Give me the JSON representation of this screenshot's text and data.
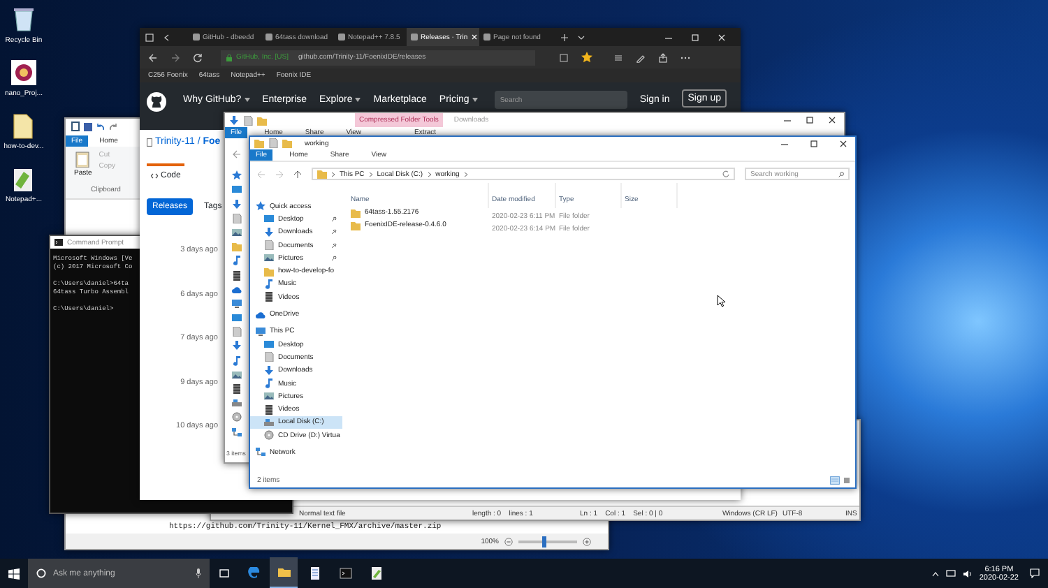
{
  "desktop_icons": [
    {
      "label": "Recycle Bin",
      "kind": "bin"
    },
    {
      "label": "nano_Proj...",
      "kind": "app"
    },
    {
      "label": "how-to-dev...",
      "kind": "file"
    },
    {
      "label": "Notepad+...",
      "kind": "notepad"
    }
  ],
  "wordpad": {
    "ribbon_tabs": [
      {
        "label": "File",
        "selected": true
      },
      {
        "label": "Home",
        "selected": false
      }
    ],
    "paste": "Paste",
    "small_buttons": [
      {
        "label": "Cut",
        "disabled": true
      },
      {
        "label": "Copy",
        "disabled": true
      }
    ],
    "group_label": "Clipboard",
    "lines": [
      "https://github.com/Trinity-11/Kernel_FMX/archive/master.zip"
    ],
    "zoom": "100%",
    "level": 0.45
  },
  "notepadpp": {
    "status_bar": [
      "Normal text file",
      "length : 0    lines : 1",
      "Ln : 1    Col : 1    Sel : 0 | 0",
      "Windows (CR LF)",
      "UTF-8",
      "INS"
    ]
  },
  "command_prompt": {
    "title": "Command Prompt",
    "blocks": [
      [
        "Microsoft Windows [Ve",
        "(c) 2017 Microsoft Co"
      ],
      [
        "C:\\Users\\daniel>64ta",
        "64tass Turbo Assembl"
      ],
      [
        "C:\\Users\\daniel>"
      ]
    ]
  },
  "browser": {
    "tabs": [
      {
        "label": "GitHub - dbeedd",
        "selected": false
      },
      {
        "label": "64tass download",
        "selected": false
      },
      {
        "label": "Notepad++ 7.8.5",
        "selected": false
      },
      {
        "label": "Releases · Trin",
        "selected": true
      },
      {
        "label": "Page not found",
        "selected": false
      }
    ],
    "certificate": "GitHub, Inc. [US]",
    "url": "github.com/Trinity-11/FoenixIDE/releases",
    "bookmarks": [
      "C256 Foenix",
      "64tass",
      "Notepad++",
      "Foenix IDE"
    ],
    "nav": [
      {
        "label": "Why GitHub?",
        "dropdown": true
      },
      {
        "label": "Enterprise",
        "dropdown": false
      },
      {
        "label": "Explore",
        "dropdown": true
      },
      {
        "label": "Marketplace",
        "dropdown": false
      },
      {
        "label": "Pricing",
        "dropdown": true
      }
    ],
    "search_placeholder": "Search",
    "sign_in": "Sign in",
    "sign_up": "Sign up",
    "repo": "Trinity-11 / **Foe**",
    "repo_tabs": [
      {
        "label": "Code",
        "selected": true
      }
    ],
    "release_tabs": [
      {
        "label": "Releases",
        "selected": true
      },
      {
        "label": "Tags",
        "selected": false
      }
    ],
    "dates": [
      "3 days ago",
      "6 days ago",
      "7 days ago",
      "9 days ago",
      "10 days ago"
    ]
  },
  "explorer_back": {
    "context_label": "Compressed Folder Tools",
    "title": "Downloads",
    "ribbon_tabs": [
      {
        "label": "File",
        "selected": true
      },
      {
        "label": "Home",
        "selected": false
      },
      {
        "label": "Share",
        "selected": false
      },
      {
        "label": "View",
        "selected": false
      }
    ],
    "context_tab": "Extract",
    "status": "3 items"
  },
  "explorer": {
    "title": "working",
    "ribbon_tabs": [
      {
        "label": "File",
        "selected": true
      },
      {
        "label": "Home",
        "selected": false
      },
      {
        "label": "Share",
        "selected": false
      },
      {
        "label": "View",
        "selected": false
      }
    ],
    "breadcrumb": [
      "This PC",
      "Local Disk (C:)",
      "working"
    ],
    "search_placeholder": "Search working",
    "columns": [
      "Name",
      "Date modified",
      "Type",
      "Size"
    ],
    "rows": [
      {
        "name": "64tass-1.55.2176",
        "date": "2020-02-23 6:11 PM",
        "type": "File folder"
      },
      {
        "name": "FoenixIDE-release-0.4.6.0",
        "date": "2020-02-23 6:14 PM",
        "type": "File folder"
      }
    ],
    "nav": [
      {
        "label": "Quick access",
        "kind": "star",
        "selected": false,
        "children": [
          {
            "label": "Desktop",
            "kind": "desktop",
            "pinned": true,
            "selected": false
          },
          {
            "label": "Downloads",
            "kind": "download",
            "pinned": true,
            "selected": false
          },
          {
            "label": "Documents",
            "kind": "document",
            "pinned": true,
            "selected": false
          },
          {
            "label": "Pictures",
            "kind": "picture",
            "pinned": true,
            "selected": false
          },
          {
            "label": "how-to-develop-fo",
            "kind": "folder",
            "pinned": false,
            "selected": false
          },
          {
            "label": "Music",
            "kind": "music",
            "pinned": false,
            "selected": false
          },
          {
            "label": "Videos",
            "kind": "video",
            "pinned": false,
            "selected": false
          }
        ]
      },
      {
        "label": "OneDrive",
        "kind": "cloud",
        "selected": false
      },
      {
        "label": "This PC",
        "kind": "pc",
        "selected": false,
        "children": [
          {
            "label": "Desktop",
            "kind": "desktop",
            "selected": false
          },
          {
            "label": "Documents",
            "kind": "document",
            "selected": false
          },
          {
            "label": "Downloads",
            "kind": "download",
            "selected": false
          },
          {
            "label": "Music",
            "kind": "music",
            "selected": false
          },
          {
            "label": "Pictures",
            "kind": "picture",
            "selected": false
          },
          {
            "label": "Videos",
            "kind": "video",
            "selected": false
          },
          {
            "label": "Local Disk (C:)",
            "kind": "drive",
            "selected": true
          },
          {
            "label": "CD Drive (D:) Virtua",
            "kind": "disc",
            "selected": false
          }
        ]
      },
      {
        "label": "Network",
        "kind": "network",
        "selected": false
      }
    ],
    "status": "2 items"
  },
  "taskbar": {
    "search_placeholder": "Ask me anything",
    "apps": [
      {
        "kind": "edge",
        "active": false
      },
      {
        "kind": "explorer",
        "active": true
      },
      {
        "kind": "wordpad",
        "active": false
      },
      {
        "kind": "console",
        "active": false
      },
      {
        "kind": "notepad",
        "active": false
      }
    ],
    "time": "6:16 PM",
    "date": "2020-02-22"
  }
}
